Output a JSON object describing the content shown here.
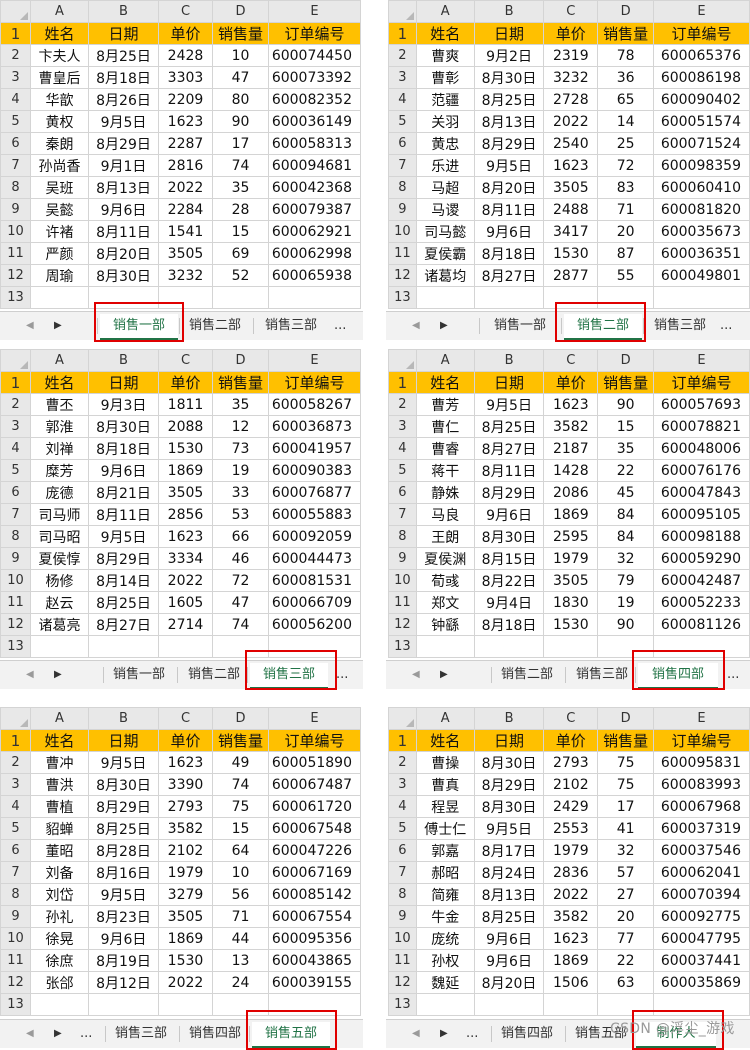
{
  "columns": [
    "A",
    "B",
    "C",
    "D",
    "E"
  ],
  "headers": [
    "姓名",
    "日期",
    "单价",
    "销售量",
    "订单编号"
  ],
  "row_numbers": [
    "1",
    "2",
    "3",
    "4",
    "5",
    "6",
    "7",
    "8",
    "9",
    "10",
    "11",
    "12",
    "13"
  ],
  "nav": {
    "prev": "◀",
    "next": "▶",
    "more": "..."
  },
  "watermark": "CSDN @浮尘_游戏",
  "panels": [
    {
      "rows": [
        [
          "卞夫人",
          "8月25日",
          "2428",
          "10",
          "600074450"
        ],
        [
          "曹皇后",
          "8月18日",
          "3303",
          "47",
          "600073392"
        ],
        [
          "华歆",
          "8月26日",
          "2209",
          "80",
          "600082352"
        ],
        [
          "黄权",
          "9月5日",
          "1623",
          "90",
          "600036149"
        ],
        [
          "秦朗",
          "8月29日",
          "2287",
          "17",
          "600058313"
        ],
        [
          "孙尚香",
          "9月1日",
          "2816",
          "74",
          "600094681"
        ],
        [
          "吴班",
          "8月13日",
          "2022",
          "35",
          "600042368"
        ],
        [
          "吴懿",
          "9月6日",
          "2284",
          "28",
          "600079387"
        ],
        [
          "许褚",
          "8月11日",
          "1541",
          "15",
          "600062921"
        ],
        [
          "严颜",
          "8月20日",
          "3505",
          "69",
          "600062998"
        ],
        [
          "周瑜",
          "8月30日",
          "3232",
          "52",
          "600065938"
        ]
      ],
      "tabs": [
        "销售一部",
        "销售二部",
        "销售三部"
      ],
      "active_tab": "销售一部"
    },
    {
      "rows": [
        [
          "曹爽",
          "9月2日",
          "2319",
          "78",
          "600065376"
        ],
        [
          "曹彰",
          "8月30日",
          "3232",
          "36",
          "600086198"
        ],
        [
          "范疆",
          "8月25日",
          "2728",
          "65",
          "600090402"
        ],
        [
          "关羽",
          "8月13日",
          "2022",
          "14",
          "600051574"
        ],
        [
          "黄忠",
          "8月29日",
          "2540",
          "25",
          "600071524"
        ],
        [
          "乐进",
          "9月5日",
          "1623",
          "72",
          "600098359"
        ],
        [
          "马超",
          "8月20日",
          "3505",
          "83",
          "600060410"
        ],
        [
          "马谡",
          "8月11日",
          "2488",
          "71",
          "600081820"
        ],
        [
          "司马懿",
          "9月6日",
          "3417",
          "20",
          "600035673"
        ],
        [
          "夏侯霸",
          "8月18日",
          "1530",
          "87",
          "600036351"
        ],
        [
          "诸葛均",
          "8月27日",
          "2877",
          "55",
          "600049801"
        ]
      ],
      "tabs": [
        "销售一部",
        "销售二部",
        "销售三部"
      ],
      "active_tab": "销售二部"
    },
    {
      "rows": [
        [
          "曹丕",
          "9月3日",
          "1811",
          "35",
          "600058267"
        ],
        [
          "郭淮",
          "8月30日",
          "2088",
          "12",
          "600036873"
        ],
        [
          "刘禅",
          "8月18日",
          "1530",
          "73",
          "600041957"
        ],
        [
          "糜芳",
          "9月6日",
          "1869",
          "19",
          "600090383"
        ],
        [
          "庞德",
          "8月21日",
          "3505",
          "33",
          "600076877"
        ],
        [
          "司马师",
          "8月11日",
          "2856",
          "53",
          "600055883"
        ],
        [
          "司马昭",
          "9月5日",
          "1623",
          "66",
          "600092059"
        ],
        [
          "夏侯惇",
          "8月29日",
          "3334",
          "46",
          "600044473"
        ],
        [
          "杨修",
          "8月14日",
          "2022",
          "72",
          "600081531"
        ],
        [
          "赵云",
          "8月25日",
          "1605",
          "47",
          "600066709"
        ],
        [
          "诸葛亮",
          "8月27日",
          "2714",
          "74",
          "600056200"
        ]
      ],
      "tabs": [
        "销售一部",
        "销售二部",
        "销售三部"
      ],
      "active_tab": "销售三部"
    },
    {
      "rows": [
        [
          "曹芳",
          "9月5日",
          "1623",
          "90",
          "600057693"
        ],
        [
          "曹仁",
          "8月25日",
          "3582",
          "15",
          "600078821"
        ],
        [
          "曹睿",
          "8月27日",
          "2187",
          "35",
          "600048006"
        ],
        [
          "蒋干",
          "8月11日",
          "1428",
          "22",
          "600076176"
        ],
        [
          "静姝",
          "8月29日",
          "2086",
          "45",
          "600047843"
        ],
        [
          "马良",
          "9月6日",
          "1869",
          "84",
          "600095105"
        ],
        [
          "王朗",
          "8月30日",
          "2595",
          "84",
          "600098188"
        ],
        [
          "夏侯渊",
          "8月15日",
          "1979",
          "32",
          "600059290"
        ],
        [
          "荀彧",
          "8月22日",
          "3505",
          "79",
          "600042487"
        ],
        [
          "郑文",
          "9月4日",
          "1830",
          "19",
          "600052233"
        ],
        [
          "钟繇",
          "8月18日",
          "1530",
          "90",
          "600081126"
        ]
      ],
      "tabs": [
        "销售二部",
        "销售三部",
        "销售四部"
      ],
      "active_tab": "销售四部"
    },
    {
      "rows": [
        [
          "曹冲",
          "9月5日",
          "1623",
          "49",
          "600051890"
        ],
        [
          "曹洪",
          "8月30日",
          "3390",
          "74",
          "600067487"
        ],
        [
          "曹植",
          "8月29日",
          "2793",
          "75",
          "600061720"
        ],
        [
          "貂蝉",
          "8月25日",
          "3582",
          "15",
          "600067548"
        ],
        [
          "董昭",
          "8月28日",
          "2102",
          "64",
          "600047226"
        ],
        [
          "刘备",
          "8月16日",
          "1979",
          "10",
          "600067169"
        ],
        [
          "刘岱",
          "9月5日",
          "3279",
          "56",
          "600085142"
        ],
        [
          "孙礼",
          "8月23日",
          "3505",
          "71",
          "600067554"
        ],
        [
          "徐晃",
          "9月6日",
          "1869",
          "44",
          "600095356"
        ],
        [
          "徐庶",
          "8月19日",
          "1530",
          "13",
          "600043865"
        ],
        [
          "张郃",
          "8月12日",
          "2022",
          "24",
          "600039155"
        ]
      ],
      "tabs": [
        "销售三部",
        "销售四部",
        "销售五部"
      ],
      "active_tab": "销售五部"
    },
    {
      "rows": [
        [
          "曹操",
          "8月30日",
          "2793",
          "75",
          "600095831"
        ],
        [
          "曹真",
          "8月29日",
          "2102",
          "75",
          "600083993"
        ],
        [
          "程昱",
          "8月30日",
          "2429",
          "17",
          "600067968"
        ],
        [
          "傅士仁",
          "9月5日",
          "2553",
          "41",
          "600037319"
        ],
        [
          "郭嘉",
          "8月17日",
          "1979",
          "32",
          "600037546"
        ],
        [
          "郝昭",
          "8月24日",
          "2836",
          "57",
          "600062041"
        ],
        [
          "简雍",
          "8月13日",
          "2022",
          "27",
          "600070394"
        ],
        [
          "牛金",
          "8月25日",
          "3582",
          "20",
          "600092775"
        ],
        [
          "庞统",
          "9月6日",
          "1623",
          "77",
          "600047795"
        ],
        [
          "孙权",
          "9月6日",
          "1869",
          "22",
          "600037441"
        ],
        [
          "魏延",
          "8月20日",
          "1506",
          "63",
          "600035869"
        ]
      ],
      "tabs": [
        "销售四部",
        "销售五部",
        "制作人"
      ],
      "active_tab": "制作人"
    }
  ]
}
